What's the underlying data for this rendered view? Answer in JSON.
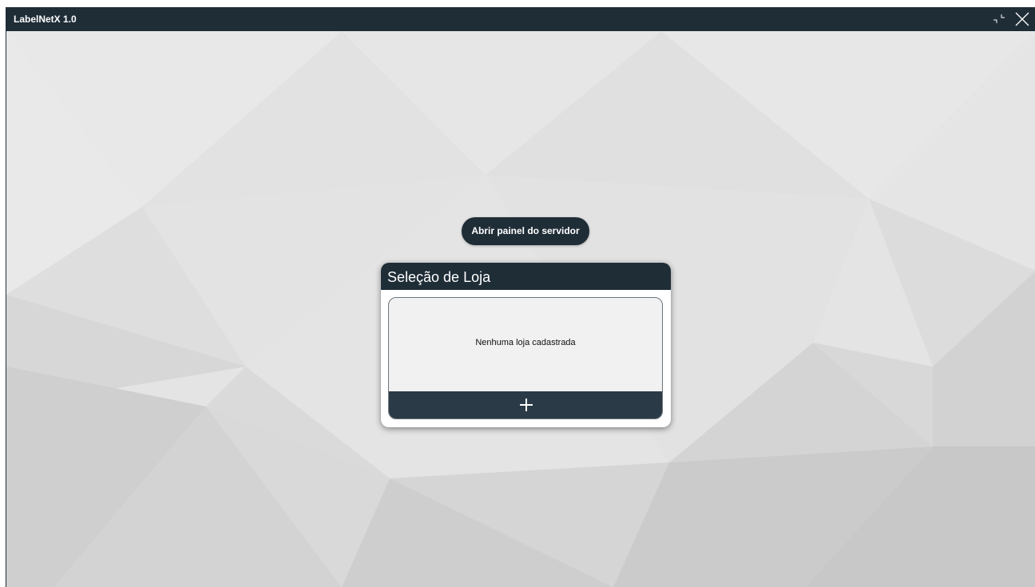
{
  "window": {
    "title": "LabelNetX 1.0",
    "icons": {
      "restore": "restore-window-icon",
      "close": "close-icon"
    }
  },
  "main": {
    "server_button_label": "Abrir painel do servidor",
    "store_selection": {
      "title": "Seleção de Loja",
      "empty_message": "Nenhuma loja cadastrada",
      "add_icon": "plus-icon"
    }
  },
  "colors": {
    "titlebar": "#1f2d37",
    "button": "#1f2d37",
    "add_bar": "#2a3b47",
    "list_background": "#f1f1f1",
    "background": "#e3e3e3"
  }
}
